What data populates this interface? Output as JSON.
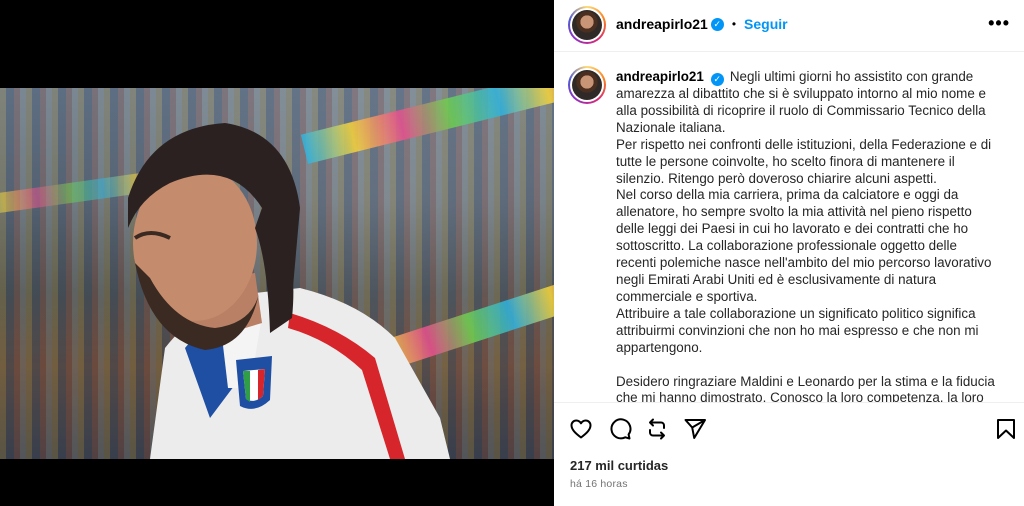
{
  "post": {
    "username": "andreapirlo21",
    "verified": true,
    "follow_label": "Seguir",
    "separator": "•",
    "more_icon": "more-horizontal-icon",
    "caption_paragraphs": [
      "Negli ultimi giorni ho assistito con grande amarezza al dibattito che si è sviluppato intorno al mio nome e alla possibilità di ricoprire il ruolo di Commissario Tecnico della Nazionale italiana.",
      "Per rispetto nei confronti delle istituzioni, della Federazione e di tutte le persone coinvolte, ho scelto finora di mantenere il silenzio. Ritengo però doveroso chiarire alcuni aspetti.",
      "Nel corso della mia carriera, prima da calciatore e oggi da allenatore, ho sempre svolto la mia attività nel pieno rispetto delle leggi dei Paesi in cui ho lavorato e dei contratti che ho sottoscritto. La collaborazione professionale oggetto delle recenti polemiche nasce nell'ambito del mio percorso lavorativo negli Emirati Arabi Uniti ed è esclusivamente di natura commerciale e sportiva.",
      "Attribuire a tale collaborazione un significato politico significa attribuirmi convinzioni che non ho mai espresso e che non mi appartengono.",
      "Desidero ringraziare Maldini e Leonardo per la stima e la fiducia che mi hanno dimostrato. Conosco la loro competenza, la loro"
    ],
    "likes": "217 mil curtidas",
    "timestamp": "há 16 horas",
    "icons": {
      "like": "heart-icon",
      "comment": "comment-icon",
      "repost": "repost-icon",
      "share": "send-icon",
      "save": "bookmark-icon"
    }
  },
  "colors": {
    "accent": "#0095f6",
    "text": "#262626",
    "muted": "#737373"
  }
}
